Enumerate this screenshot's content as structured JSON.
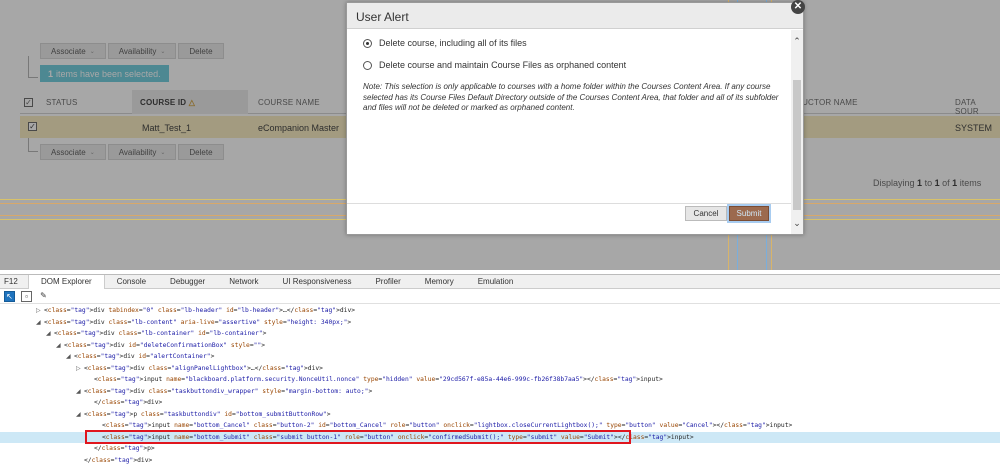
{
  "page": {
    "action_buttons": [
      "Associate",
      "Availability",
      "Delete"
    ],
    "selection_count": "1",
    "selection_text": "items have been selected.",
    "columns": [
      "STATUS",
      "COURSE ID",
      "COURSE NAME",
      "TRUCTOR NAME",
      "DATA SOUR"
    ],
    "sort_indicator": "△",
    "row": {
      "course_id": "Matt_Test_1",
      "course_name": "eCompanion Master",
      "data_source": "SYSTEM"
    },
    "displaying": {
      "pre": "Displaying",
      "from": "1",
      "mid1": "to",
      "to": "1",
      "mid2": "of",
      "total": "1",
      "post": "items"
    }
  },
  "modal": {
    "title": "User Alert",
    "close_glyph": "✕",
    "options": [
      {
        "label": "Delete course, including all of its files",
        "selected": true
      },
      {
        "label": "Delete course and maintain Course Files as orphaned content",
        "selected": false
      }
    ],
    "note": "Note: This selection is only applicable to courses with a home folder within the Courses Content Area. If any course selected has its Course Files Default Directory outside of the Courses Content Area, that folder and all of its subfolder and files will not be deleted or marked as orphaned content.",
    "cancel_label": "Cancel",
    "submit_label": "Submit",
    "scroll_up_glyph": "⌃",
    "scroll_down_glyph": "⌄"
  },
  "devtools": {
    "f12_label": "F12",
    "tabs": [
      "DOM Explorer",
      "Console",
      "Debugger",
      "Network",
      "UI Responsiveness",
      "Profiler",
      "Memory",
      "Emulation"
    ],
    "active_tab": "DOM Explorer",
    "toolbar_icons": [
      "select-element-icon",
      "box-model-icon",
      "pen-icon"
    ],
    "dom_lines": [
      {
        "indent": 36,
        "tw": "▷",
        "text": "<div tabindex=\"0\" class=\"lb-header\" id=\"lb-header\">…</div>"
      },
      {
        "indent": 36,
        "tw": "◢",
        "text": "<div class=\"lb-content\" aria-live=\"assertive\" style=\"height: 340px;\">"
      },
      {
        "indent": 46,
        "tw": "◢",
        "text": "<div class=\"lb-container\" id=\"lb-container\">"
      },
      {
        "indent": 56,
        "tw": "◢",
        "text": "<div id=\"deleteConfirmationBox\" style=\"\">"
      },
      {
        "indent": 66,
        "tw": "◢",
        "text": "<div id=\"alertContainer\">"
      },
      {
        "indent": 76,
        "tw": "▷",
        "text": "<div class=\"alignPanelLightbox\">…</div>"
      },
      {
        "indent": 86,
        "tw": "",
        "text": "<input name=\"blackboard.platform.security.NonceUtil.nonce\" type=\"hidden\" value=\"29cd567f-e85a-44e6-999c-fb26f38b7aa5\"></input>"
      },
      {
        "indent": 76,
        "tw": "◢",
        "text": "<div class=\"taskbuttondiv_wrapper\" style=\"margin-bottom: auto;\">"
      },
      {
        "indent": 86,
        "tw": "",
        "text": "</div>"
      },
      {
        "indent": 76,
        "tw": "◢",
        "text": "<p class=\"taskbuttondiv\" id=\"bottom_submitButtonRow\">"
      },
      {
        "indent": 94,
        "tw": "",
        "text": "<input name=\"bottom_Cancel\" class=\"button-2\" id=\"bottom_Cancel\" role=\"button\" onclick=\"lightbox.closeCurrentLightbox();\" type=\"button\" value=\"Cancel\"></input>"
      },
      {
        "indent": 94,
        "tw": "",
        "text": "<input name=\"bottom_Submit\" class=\"submit button-1\" role=\"button\" onclick=\"confirmedSubmit();\" type=\"submit\" value=\"Submit\"></input>",
        "selected": true
      },
      {
        "indent": 86,
        "tw": "",
        "text": "</p>"
      },
      {
        "indent": 76,
        "tw": "",
        "text": "</div>"
      }
    ]
  }
}
